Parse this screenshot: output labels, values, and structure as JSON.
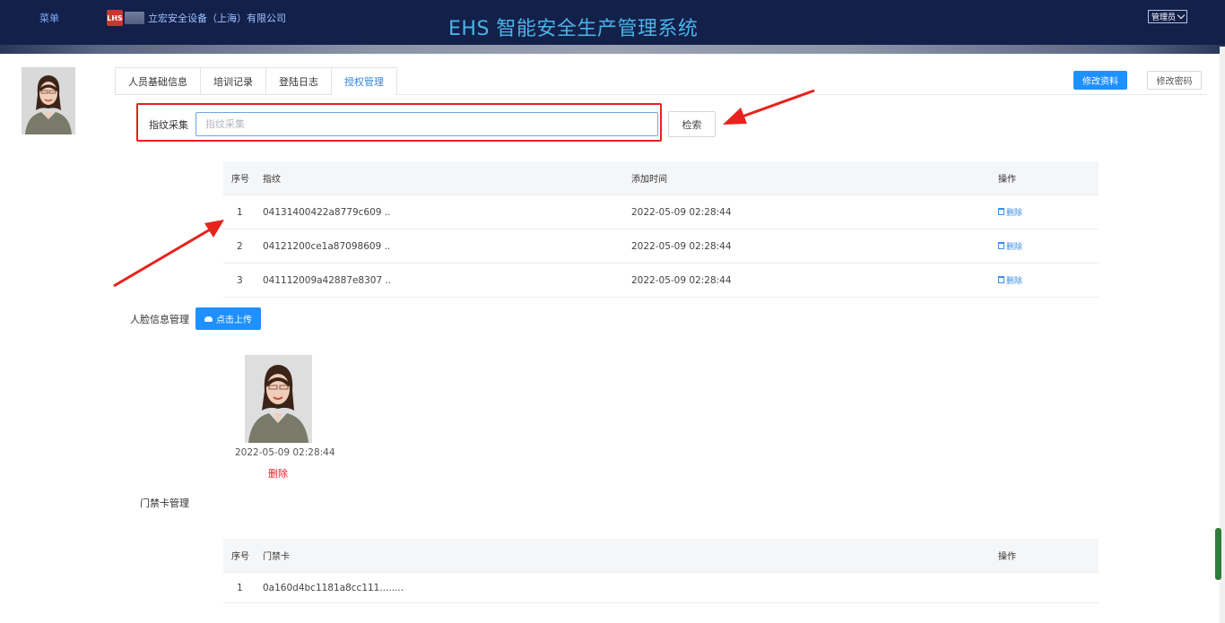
{
  "header": {
    "menu_label": "菜单",
    "company": "立宏安全设备（上海）有限公司",
    "title": "EHS 智能安全生产管理系统",
    "user_label": "管理员",
    "logo_text": "LHS"
  },
  "tabs": [
    {
      "label": "人员基础信息"
    },
    {
      "label": "培训记录"
    },
    {
      "label": "登陆日志"
    },
    {
      "label": "授权管理"
    }
  ],
  "active_tab": "授权管理",
  "actions": {
    "edit_profile": "修改资料",
    "change_password": "修改密码"
  },
  "fingerprint": {
    "label": "指纹采集",
    "placeholder": "指纹采集",
    "value": "",
    "search_label": "检索",
    "columns": [
      "序号",
      "指纹",
      "添加时间",
      "操作"
    ],
    "rows": [
      {
        "idx": "1",
        "fingerprint": "04131400422a8779c609 ..",
        "time": "2022-05-09 02:28:44",
        "op": "删除"
      },
      {
        "idx": "2",
        "fingerprint": "04121200ce1a87098609 ..",
        "time": "2022-05-09 02:28:44",
        "op": "删除"
      },
      {
        "idx": "3",
        "fingerprint": "041112009a42887e8307 ..",
        "time": "2022-05-09 02:28:44",
        "op": "删除"
      }
    ]
  },
  "face": {
    "label": "人脸信息管理",
    "upload_label": "点击上传",
    "photo_time": "2022-05-09 02:28:44",
    "delete_label": "删除"
  },
  "access_card": {
    "label": "门禁卡管理",
    "columns": [
      "序号",
      "门禁卡",
      "操作"
    ],
    "rows": [
      {
        "idx": "1",
        "card": "0a160d4bc1181a8cc111........",
        "op": ""
      }
    ]
  },
  "colors": {
    "header_bg": "#13204a",
    "title": "#49b4e8",
    "primary": "#1e90ff",
    "danger": "#e02020",
    "annotation": "#e8221c"
  }
}
